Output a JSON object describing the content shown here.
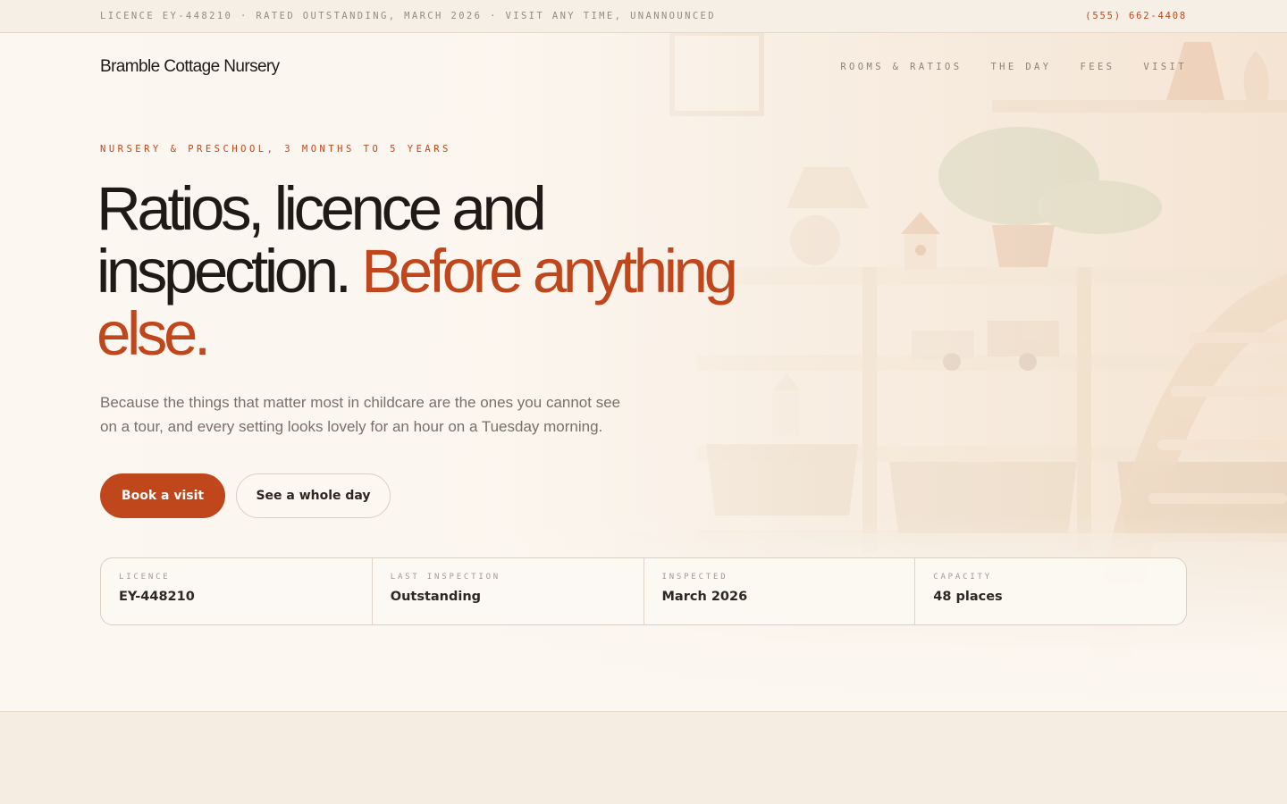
{
  "topbar": {
    "notice": "LICENCE EY-448210 · RATED OUTSTANDING, MARCH 2026 · VISIT ANY TIME, UNANNOUNCED",
    "phone": "(555) 662-4408"
  },
  "nav": {
    "brand": "Bramble Cottage Nursery",
    "links": [
      "ROOMS & RATIOS",
      "THE DAY",
      "FEES",
      "VISIT"
    ]
  },
  "hero": {
    "eyebrow": "NURSERY & PRESCHOOL, 3 MONTHS TO 5 YEARS",
    "headline_plain": "Ratios, licence and inspection.",
    "headline_accent": "Before anything else.",
    "lede": "Because the things that matter most in childcare are the ones you cannot see on a tour, and every setting looks lovely for an hour on a Tuesday morning.",
    "primary_cta": "Book a visit",
    "secondary_cta": "See a whole day"
  },
  "facts": [
    {
      "label": "LICENCE",
      "value": "EY-448210"
    },
    {
      "label": "LAST INSPECTION",
      "value": "Outstanding"
    },
    {
      "label": "INSPECTED",
      "value": "March 2026"
    },
    {
      "label": "CAPACITY",
      "value": "48 places"
    }
  ],
  "colors": {
    "accent": "#c0461c",
    "ink": "#1f1a16",
    "muted": "#7a7068",
    "cream": "#fcf7f1",
    "sand": "#f6ede2"
  },
  "icons": [
    "nursery-shelf-illustration",
    "table-lamp-illustration",
    "potted-plant-illustration",
    "toy-truck-illustration",
    "pikler-arch-illustration",
    "wicker-basket-illustration",
    "birdhouse-illustration"
  ]
}
